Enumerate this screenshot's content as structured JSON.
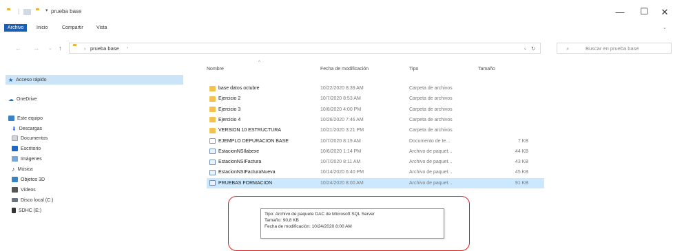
{
  "title_bar": {
    "path_text": "prueba base",
    "minimize": "—",
    "maximize": "☐",
    "close": "✕"
  },
  "ribbon": {
    "tabs": [
      "Archivo",
      "Inicio",
      "Compartir",
      "Vista"
    ]
  },
  "address": {
    "path": "prueba base",
    "search_placeholder": "Buscar en prueba base"
  },
  "nav_pane": {
    "items": [
      {
        "label": "Acceso rápido",
        "icon": "star-icon",
        "color": "#1a5fb4"
      },
      {
        "label": "OneDrive",
        "icon": "cloud-icon",
        "color": "#2b6cb0"
      },
      {
        "label": "Este equipo",
        "icon": "computer-icon",
        "color": "#3b82c4"
      },
      {
        "label": "Descargas",
        "icon": "download-icon",
        "color": "#2563eb"
      },
      {
        "label": "Documentos",
        "icon": "documents-icon",
        "color": "#9ca3af"
      },
      {
        "label": "Escritorio",
        "icon": "desktop-icon",
        "color": "#1e66c4"
      },
      {
        "label": "Imágenes",
        "icon": "images-icon",
        "color": "#7aa7d8"
      },
      {
        "label": "Música",
        "icon": "music-icon",
        "color": "#333333"
      },
      {
        "label": "Objetos 3D",
        "icon": "cube-icon",
        "color": "#3b82c4"
      },
      {
        "label": "Vídeos",
        "icon": "video-icon",
        "color": "#555555"
      },
      {
        "label": "Disco local (C:)",
        "icon": "drive-icon",
        "color": "#6b7280"
      },
      {
        "label": "SDHC (E:)",
        "icon": "sdcard-icon",
        "color": "#333333"
      }
    ]
  },
  "columns": {
    "name": "Nombre",
    "date": "Fecha de modificación",
    "type": "Tipo",
    "size": "Tamaño"
  },
  "files": [
    {
      "name": "base datos octubre",
      "date": "10/22/2020 8:39 AM",
      "type": "Carpeta de archivos",
      "size": "",
      "kind": "folder"
    },
    {
      "name": "Ejercicio 2",
      "date": "10/7/2020 8:53 AM",
      "type": "Carpeta de archivos",
      "size": "",
      "kind": "folder"
    },
    {
      "name": "Ejercicio 3",
      "date": "10/8/2020 4:00 PM",
      "type": "Carpeta de archivos",
      "size": "",
      "kind": "folder"
    },
    {
      "name": "Ejercicio 4",
      "date": "10/26/2020 7:46 AM",
      "type": "Carpeta de archivos",
      "size": "",
      "kind": "folder"
    },
    {
      "name": "VERSION 10 ESTRUCTURA",
      "date": "10/21/2020 3:21 PM",
      "type": "Carpeta de archivos",
      "size": "",
      "kind": "folder"
    },
    {
      "name": "EJEMPLO DEPURACION BASE",
      "date": "10/7/2020 8:19 AM",
      "type": "Documento de te...",
      "size": "7 KB",
      "kind": "doc"
    },
    {
      "name": "EstacionNSIlabexe",
      "date": "10/6/2020 1:14 PM",
      "type": "Archivo de paquet...",
      "size": "44 KB",
      "kind": "file"
    },
    {
      "name": "EstacionNSIFactura",
      "date": "10/7/2020 8:11 AM",
      "type": "Archivo de paquet...",
      "size": "43 KB",
      "kind": "file"
    },
    {
      "name": "EstacionNSIFacturaNueva",
      "date": "10/14/2020 6:40 PM",
      "type": "Archivo de paquet...",
      "size": "45 KB",
      "kind": "file"
    },
    {
      "name": "PRUEBAS FORMACION",
      "date": "10/24/2020 8:00 AM",
      "type": "Archivo de paquet...",
      "size": "91 KB",
      "kind": "file",
      "selected": true
    }
  ],
  "tooltip": {
    "line1": "Tipo: Archivo de paquete DAC de Microsoft SQL Server",
    "line2": "Tamaño: 90,8 KB",
    "line3": "Fecha de modificación: 10/24/2020 8:00 AM"
  }
}
